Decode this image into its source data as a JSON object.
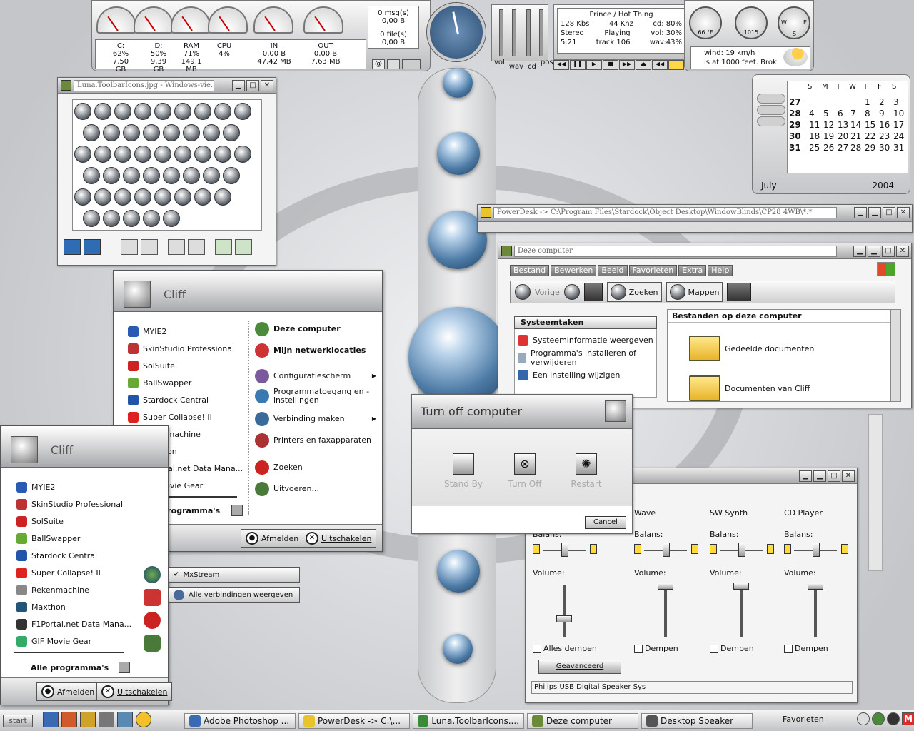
{
  "topbar": {
    "gauges": [
      "C:",
      "D:",
      "RAM",
      "CPU",
      "IN",
      "OUT"
    ],
    "stats": {
      "c_label": "C:",
      "c_pct": "62%",
      "c_size": "7,50 GB",
      "d_label": "D:",
      "d_pct": "50%",
      "d_size": "9,39 GB",
      "ram_label": "RAM",
      "ram_pct": "71%",
      "ram_size": "149,1 MB",
      "cpu_label": "CPU",
      "cpu_pct": "4%",
      "in_label": "IN",
      "in_rate": "0,00 B",
      "in_total": "47,42 MB",
      "out_label": "OUT",
      "out_rate": "0,00 B",
      "out_total": "7,63 MB"
    },
    "mail": {
      "msgs": "0 msg(s)",
      "msgs_size": "0,00 B",
      "files": "0 file(s)",
      "files_size": "0,00 B"
    },
    "mixer_labels": {
      "vol": "vol",
      "wav": "wav",
      "cd": "cd",
      "pos": "pos"
    },
    "player": {
      "title": "Prince / Hot Thing",
      "bitrate": "128 Kbs",
      "freq": "44 Khz",
      "cd": "cd: 80%",
      "mode": "Stereo",
      "state": "Playing",
      "vol": "vol: 30%",
      "time": "5:21",
      "track": "track 106",
      "wav": "wav:43%"
    },
    "weather": {
      "temp": "66 °F",
      "pressure": "1015",
      "wind": "wind: 19 km/h",
      "desc": "is at 1000 feet. Brok"
    },
    "compass": {
      "w": "W",
      "e": "E",
      "s": "S"
    }
  },
  "calendar": {
    "days": [
      "S",
      "M",
      "T",
      "W",
      "T",
      "F",
      "S"
    ],
    "rows": [
      {
        "wk": "27",
        "d": [
          "",
          "",
          "",
          "",
          "1",
          "2",
          "3"
        ]
      },
      {
        "wk": "28",
        "d": [
          "4",
          "5",
          "6",
          "7",
          "8",
          "9",
          "10"
        ]
      },
      {
        "wk": "29",
        "d": [
          "11",
          "12",
          "13",
          "14",
          "15",
          "16",
          "17"
        ]
      },
      {
        "wk": "30",
        "d": [
          "18",
          "19",
          "20",
          "21",
          "22",
          "23",
          "24"
        ]
      },
      {
        "wk": "31",
        "d": [
          "25",
          "26",
          "27",
          "28",
          "29",
          "30",
          "31"
        ]
      }
    ],
    "month": "July",
    "year": "2004"
  },
  "luna": {
    "title": "Luna.ToolbarIcons.jpg - Windows-vie..."
  },
  "powerdesk": {
    "title": "PowerDesk -> C:\\Program Files\\Stardock\\Object Desktop\\WindowBlinds\\CP28 4WB\\*.*"
  },
  "mycomputer": {
    "title": "Deze computer",
    "menu": [
      "Bestand",
      "Bewerken",
      "Beeld",
      "Favorieten",
      "Extra",
      "Help"
    ],
    "back": "Vorige",
    "search": "Zoeken",
    "folders": "Mappen",
    "tasks_title": "Systeemtaken",
    "tasks": [
      "Systeeminformatie weergeven",
      "Programma's installeren of verwijderen",
      "Een instelling wijzigen"
    ],
    "section": "Bestanden op deze computer",
    "folders_list": [
      "Gedeelde documenten",
      "Documenten van Cliff"
    ]
  },
  "startmenu": {
    "user": "Cliff",
    "left": [
      "MYIE2",
      "SkinStudio Professional",
      "SolSuite",
      "BallSwapper",
      "Stardock Central",
      "Super Collapse! II",
      "Rekenmachine",
      "Maxthon",
      "F1Portal.net Data Mana...",
      "GIF Movie Gear"
    ],
    "all_programs": "Alle programma's",
    "right": [
      "Deze computer",
      "Mijn netwerklocaties",
      "Configuratiescherm",
      "Programmatoegang en -instellingen",
      "Verbinding maken",
      "Printers en faxapparaten",
      "Zoeken",
      "Uitvoeren..."
    ],
    "logoff": "Afmelden",
    "shutdown": "Uitschakelen"
  },
  "submenu": {
    "items": [
      "MxStream",
      "Alle verbindingen weergeven"
    ]
  },
  "turnoff": {
    "title": "Turn off computer",
    "standby": "Stand By",
    "off": "Turn Off",
    "restart": "Restart",
    "cancel": "Cancel"
  },
  "volume": {
    "channels": [
      {
        "name": "",
        "balance": "Balans:",
        "volume": "Volume:",
        "mute": "Alles dempen"
      },
      {
        "name": "Wave",
        "balance": "Balans:",
        "volume": "Volume:",
        "mute": "Dempen"
      },
      {
        "name": "SW Synth",
        "balance": "Balans:",
        "volume": "Volume:",
        "mute": "Dempen"
      },
      {
        "name": "CD Player",
        "balance": "Balans:",
        "volume": "Volume:",
        "mute": "Dempen"
      }
    ],
    "advanced": "Geavanceerd",
    "device": "Philips USB Digital Speaker Sys"
  },
  "taskbar": {
    "start": "start",
    "tasks": [
      "Adobe Photoshop ...",
      "PowerDesk -> C:\\...",
      "Luna.ToolbarIcons....",
      "Deze computer",
      "Desktop Speaker"
    ],
    "favorites": "Favorieten"
  }
}
